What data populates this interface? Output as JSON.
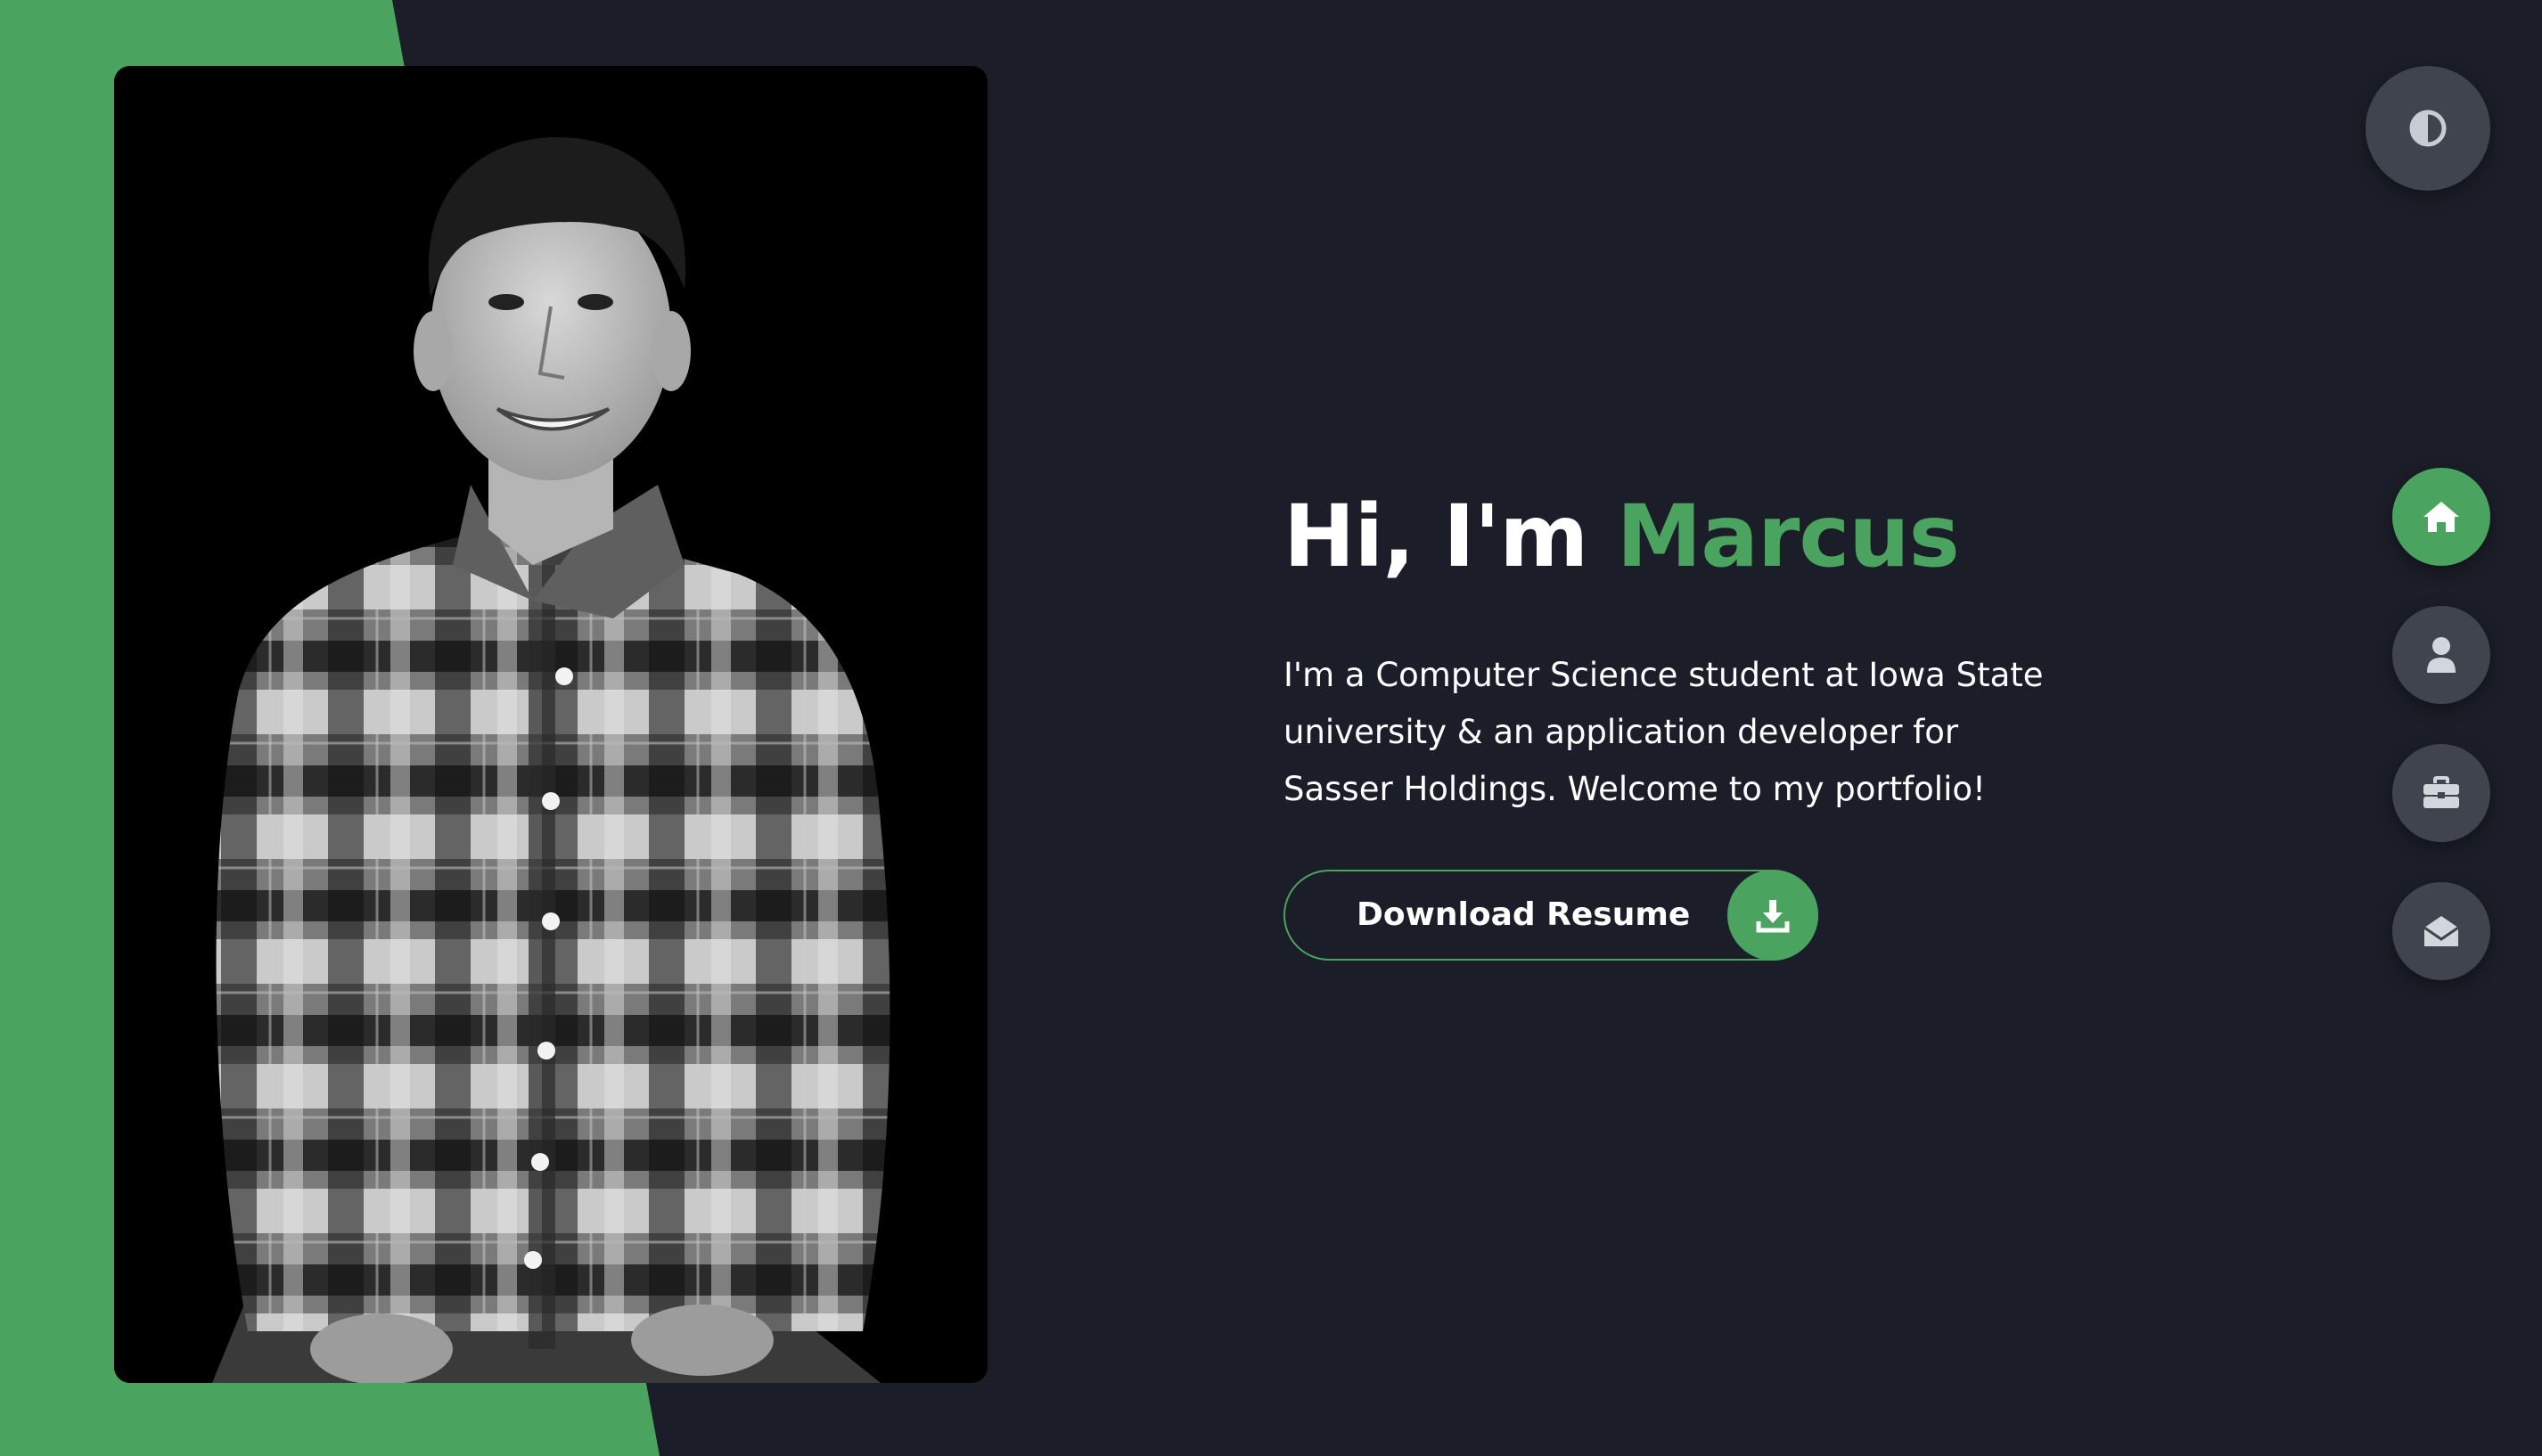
{
  "colors": {
    "accent": "#4aa35f",
    "background": "#1b1d28",
    "nav_inactive": "#40444f"
  },
  "hero": {
    "greeting": "Hi, I'm ",
    "name": "Marcus",
    "description": "I'm a Computer Science student at Iowa State university & an application developer for Sasser Holdings. Welcome to my portfolio!",
    "download_label": "Download Resume",
    "download_icon": "download-icon"
  },
  "photo": {
    "alt": "Portrait of Marcus in a black and white flannel shirt"
  },
  "theme_toggle": {
    "icon": "contrast-icon"
  },
  "nav": [
    {
      "id": "home",
      "icon": "home-icon",
      "active": true
    },
    {
      "id": "about",
      "icon": "user-icon",
      "active": false
    },
    {
      "id": "portfolio",
      "icon": "briefcase-icon",
      "active": false
    },
    {
      "id": "contact",
      "icon": "envelope-icon",
      "active": false
    }
  ]
}
